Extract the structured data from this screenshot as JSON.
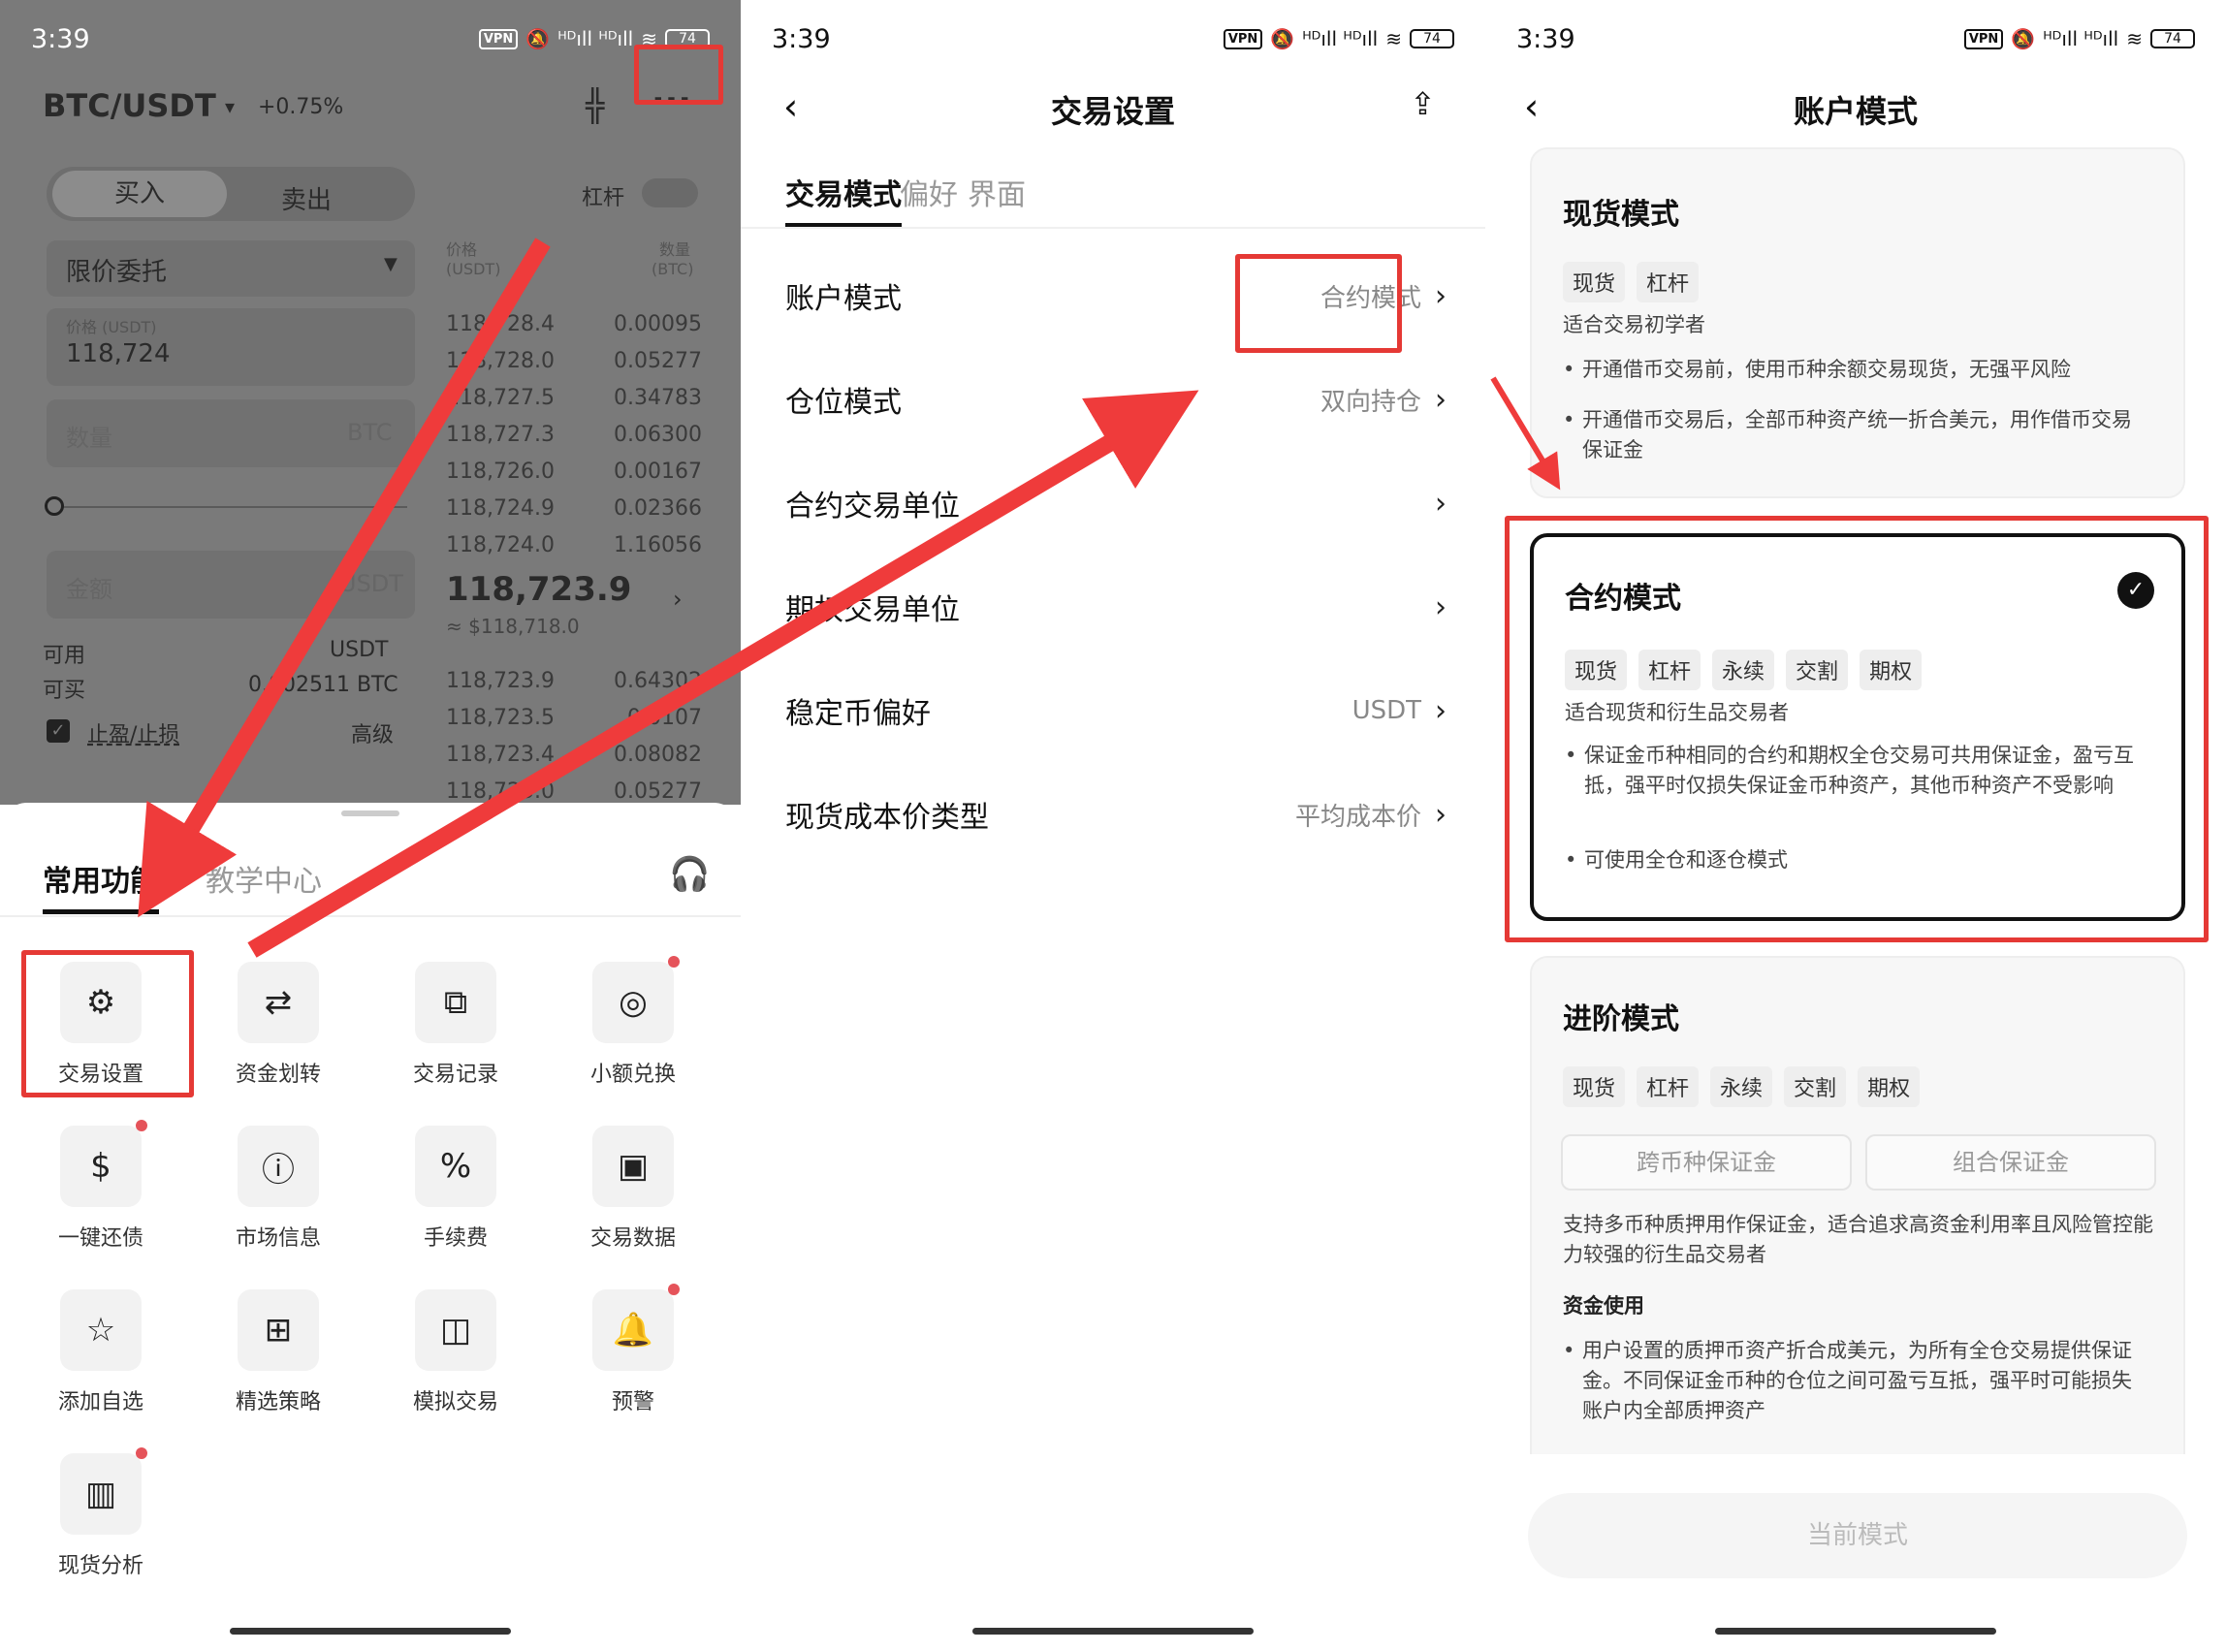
{
  "status": {
    "time": "3:39",
    "vpn": "VPN",
    "battery": "74",
    "net": "ᴴᴰıll ᴴᴰıll"
  },
  "p1": {
    "pair": "BTC/USDT",
    "change": "+0.75%",
    "buy": "买入",
    "sell": "卖出",
    "leverage": "杠杆",
    "order_type": "限价委托",
    "price_label": "价格 (USDT)",
    "price_value": "118,724",
    "qty_ph": "数量",
    "qty_unit": "BTC",
    "amount_ph": "金额",
    "amount_unit": "USDT",
    "avail": "可用",
    "avail_val": "USDT",
    "canbuy": "可买",
    "canbuy_val": "0.002511 BTC",
    "tpsl": "止盈/止损",
    "advanced": "高级",
    "ob_head_price": "价格",
    "ob_head_price_unit": "(USDT)",
    "ob_head_qty": "数量",
    "ob_head_qty_unit": "(BTC)",
    "asks": [
      [
        "118,728.4",
        "0.00095"
      ],
      [
        "118,728.0",
        "0.05277"
      ],
      [
        "118,727.5",
        "0.34783"
      ],
      [
        "118,727.3",
        "0.06300"
      ],
      [
        "118,726.0",
        "0.00167"
      ],
      [
        "118,724.9",
        "0.02366"
      ],
      [
        "118,724.0",
        "1.16056"
      ]
    ],
    "last": "118,723.9",
    "last_usd": "≈ $118,718.0",
    "bids": [
      [
        "118,723.9",
        "0.64302"
      ],
      [
        "118,723.5",
        "0.0107"
      ],
      [
        "118,723.4",
        "0.08082"
      ],
      [
        "118,723.0",
        "0.05277"
      ]
    ],
    "tab_common": "常用功能",
    "tab_teach": "教学中心",
    "grid": [
      {
        "label": "交易设置",
        "icon": "⚙",
        "dot": false
      },
      {
        "label": "资金划转",
        "icon": "⇄",
        "dot": false
      },
      {
        "label": "交易记录",
        "icon": "⧉",
        "dot": false
      },
      {
        "label": "小额兑换",
        "icon": "◎",
        "dot": true
      },
      {
        "label": "一键还债",
        "icon": "$",
        "dot": true
      },
      {
        "label": "市场信息",
        "icon": "ⓘ",
        "dot": false
      },
      {
        "label": "手续费",
        "icon": "%",
        "dot": false
      },
      {
        "label": "交易数据",
        "icon": "▣",
        "dot": false
      },
      {
        "label": "添加自选",
        "icon": "☆",
        "dot": false
      },
      {
        "label": "精选策略",
        "icon": "⊞",
        "dot": false
      },
      {
        "label": "模拟交易",
        "icon": "◫",
        "dot": false
      },
      {
        "label": "预警",
        "icon": "🔔",
        "dot": true
      },
      {
        "label": "现货分析",
        "icon": "▥",
        "dot": true
      }
    ]
  },
  "p2": {
    "title": "交易设置",
    "tabs": [
      "交易模式",
      "偏好",
      "界面"
    ],
    "rows": [
      {
        "label": "账户模式",
        "value": "合约模式"
      },
      {
        "label": "仓位模式",
        "value": "双向持仓"
      },
      {
        "label": "合约交易单位",
        "value": ""
      },
      {
        "label": "期权交易单位",
        "value": ""
      },
      {
        "label": "稳定币偏好",
        "value": "USDT"
      },
      {
        "label": "现货成本价类型",
        "value": "平均成本价"
      }
    ]
  },
  "p3": {
    "title": "账户模式",
    "spot": {
      "title": "现货模式",
      "tags": [
        "现货",
        "杠杆"
      ],
      "desc": "适合交易初学者",
      "b1": "开通借币交易前，使用币种余额交易现货，无强平风险",
      "b2": "开通借币交易后，全部币种资产统一折合美元，用作借币交易保证金"
    },
    "futures": {
      "title": "合约模式",
      "tags": [
        "现货",
        "杠杆",
        "永续",
        "交割",
        "期权"
      ],
      "desc": "适合现货和衍生品交易者",
      "b1": "保证金币种相同的合约和期权全仓交易可共用保证金，盈亏互抵，强平时仅损失保证金币种资产，其他币种资产不受影响",
      "b2": "可使用全仓和逐仓模式"
    },
    "adv": {
      "title": "进阶模式",
      "tags": [
        "现货",
        "杠杆",
        "永续",
        "交割",
        "期权"
      ],
      "opt1": "跨币种保证金",
      "opt2": "组合保证金",
      "desc": "支持多币种质押用作保证金，适合追求高资金利用率且风险管控能力较强的衍生品交易者",
      "sub": "资金使用",
      "b1": "用户设置的质押币资产折合成美元，为所有全仓交易提供保证金。不同保证金币种的仓位之间可盈亏互抵，强平时可能损失账户内全部质押资产"
    },
    "button": "当前模式"
  }
}
